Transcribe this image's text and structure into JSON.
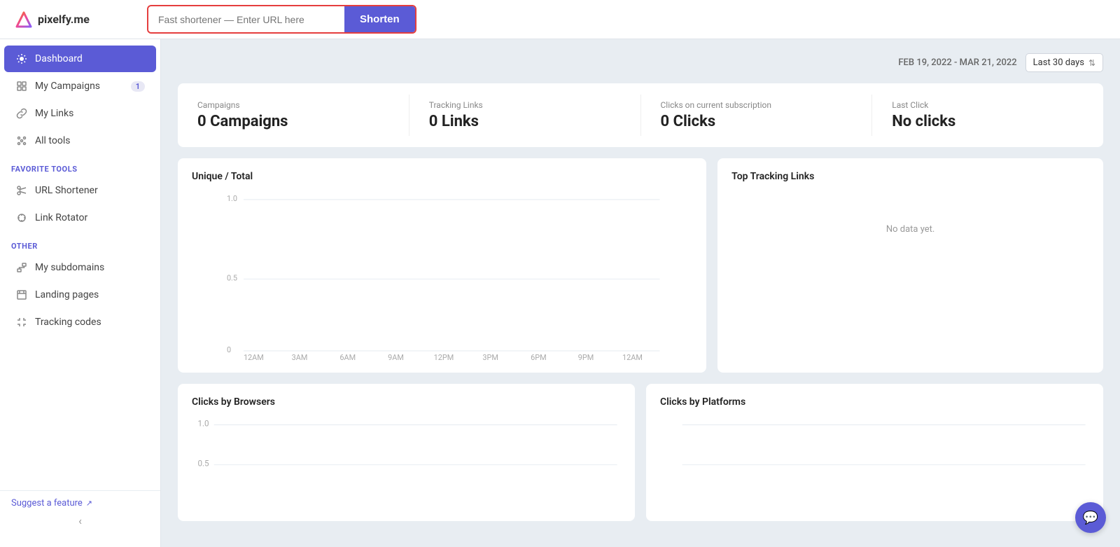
{
  "app": {
    "logo_text": "pixelfy.me"
  },
  "topbar": {
    "url_input_placeholder": "Fast shortener — Enter URL here",
    "shorten_button_label": "Shorten"
  },
  "sidebar": {
    "nav_items": [
      {
        "id": "dashboard",
        "label": "Dashboard",
        "active": true,
        "badge": null,
        "icon": "dashboard-icon"
      },
      {
        "id": "campaigns",
        "label": "My Campaigns",
        "active": false,
        "badge": "1",
        "icon": "campaigns-icon"
      },
      {
        "id": "links",
        "label": "My Links",
        "active": false,
        "badge": null,
        "icon": "links-icon"
      },
      {
        "id": "all-tools",
        "label": "All tools",
        "active": false,
        "badge": null,
        "icon": "tools-icon"
      }
    ],
    "favorite_tools_label": "FAVORITE TOOLS",
    "favorite_tools": [
      {
        "id": "url-shortener",
        "label": "URL Shortener",
        "icon": "scissors-icon"
      },
      {
        "id": "link-rotator",
        "label": "Link Rotator",
        "icon": "rotator-icon"
      }
    ],
    "other_label": "OTHER",
    "other_items": [
      {
        "id": "subdomains",
        "label": "My subdomains",
        "icon": "subdomain-icon"
      },
      {
        "id": "landing-pages",
        "label": "Landing pages",
        "icon": "landing-icon"
      },
      {
        "id": "tracking-codes",
        "label": "Tracking codes",
        "icon": "tracking-icon"
      }
    ],
    "suggest_feature_label": "Suggest a feature",
    "collapse_icon": "‹"
  },
  "content": {
    "date_range": "FEB 19, 2022 - MAR 21, 2022",
    "date_select_label": "Last 30 days",
    "stats": [
      {
        "label": "Campaigns",
        "value": "0 Campaigns"
      },
      {
        "label": "Tracking Links",
        "value": "0 Links"
      },
      {
        "label": "Clicks on current subscription",
        "value": "0 Clicks"
      },
      {
        "label": "Last Click",
        "value": "No clicks"
      }
    ],
    "chart1_title": "Unique / Total",
    "chart2_title": "Top Tracking Links",
    "chart2_no_data": "No data yet.",
    "chart3_title": "Clicks by Browsers",
    "chart4_title": "Clicks by Platforms",
    "y_axis_labels": [
      "1.0",
      "0.5",
      "0"
    ],
    "x_axis_labels": [
      "12AM",
      "3AM",
      "6AM",
      "9AM",
      "12PM",
      "3PM",
      "6PM",
      "9PM",
      "12AM"
    ]
  }
}
